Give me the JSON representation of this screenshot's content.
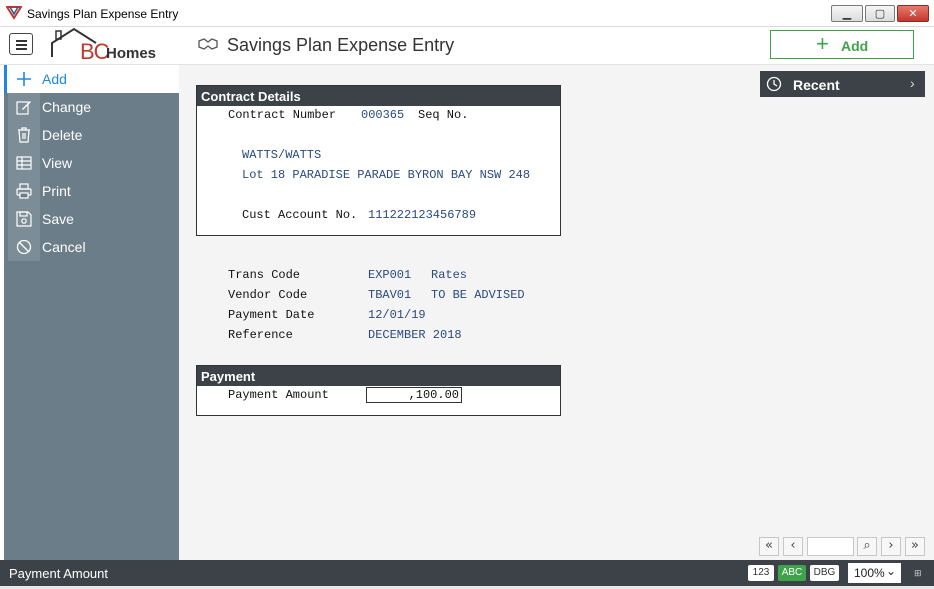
{
  "window": {
    "title": "Savings Plan Expense Entry",
    "min_glyph": "▁",
    "max_glyph": "▢",
    "close_glyph": "✕"
  },
  "header": {
    "logo_bc": "BC",
    "logo_homes": "Homes",
    "title": "Savings Plan Expense Entry",
    "add_label": "Add"
  },
  "sidebar": {
    "items": [
      {
        "label": "Add",
        "icon": "plus-icon",
        "active": true
      },
      {
        "label": "Change",
        "icon": "edit-icon"
      },
      {
        "label": "Delete",
        "icon": "trash-icon"
      },
      {
        "label": "View",
        "icon": "table-icon"
      },
      {
        "label": "Print",
        "icon": "printer-icon"
      },
      {
        "label": "Save",
        "icon": "save-icon"
      },
      {
        "label": "Cancel",
        "icon": "cancel-icon"
      }
    ]
  },
  "recent": {
    "label": "Recent"
  },
  "contract": {
    "heading": "Contract Details",
    "contract_number_label": "Contract Number",
    "contract_number": "000365",
    "seq_label": "Seq No.",
    "name": "WATTS/WATTS",
    "address": "Lot 18 PARADISE PARADE BYRON BAY NSW 248",
    "cust_account_label": "Cust Account No.",
    "cust_account": "111222123456789"
  },
  "details": {
    "trans_code_label": "Trans Code",
    "trans_code": "EXP001",
    "trans_desc": "Rates",
    "vendor_code_label": "Vendor Code",
    "vendor_code": "TBAV01",
    "vendor_desc": "TO BE ADVISED",
    "payment_date_label": "Payment Date",
    "payment_date": "12/01/19",
    "reference_label": "Reference",
    "reference": "DECEMBER 2018"
  },
  "payment": {
    "heading": "Payment",
    "amount_label": "Payment Amount",
    "amount": ",100.00"
  },
  "pager": {
    "first": "«",
    "prev": "‹",
    "next": "›",
    "last": "»",
    "search": "⌕",
    "page_value": ""
  },
  "status": {
    "message": "Payment Amount",
    "chip_123": "123",
    "chip_abc": "ABC",
    "chip_dbg": "DBG",
    "zoom": "100%",
    "zoom_chev": "⌄"
  },
  "colors": {
    "accent": "#1e88e5",
    "green": "#3ea34a",
    "dark": "#3c4247",
    "sidebar": "#6b7d88"
  }
}
